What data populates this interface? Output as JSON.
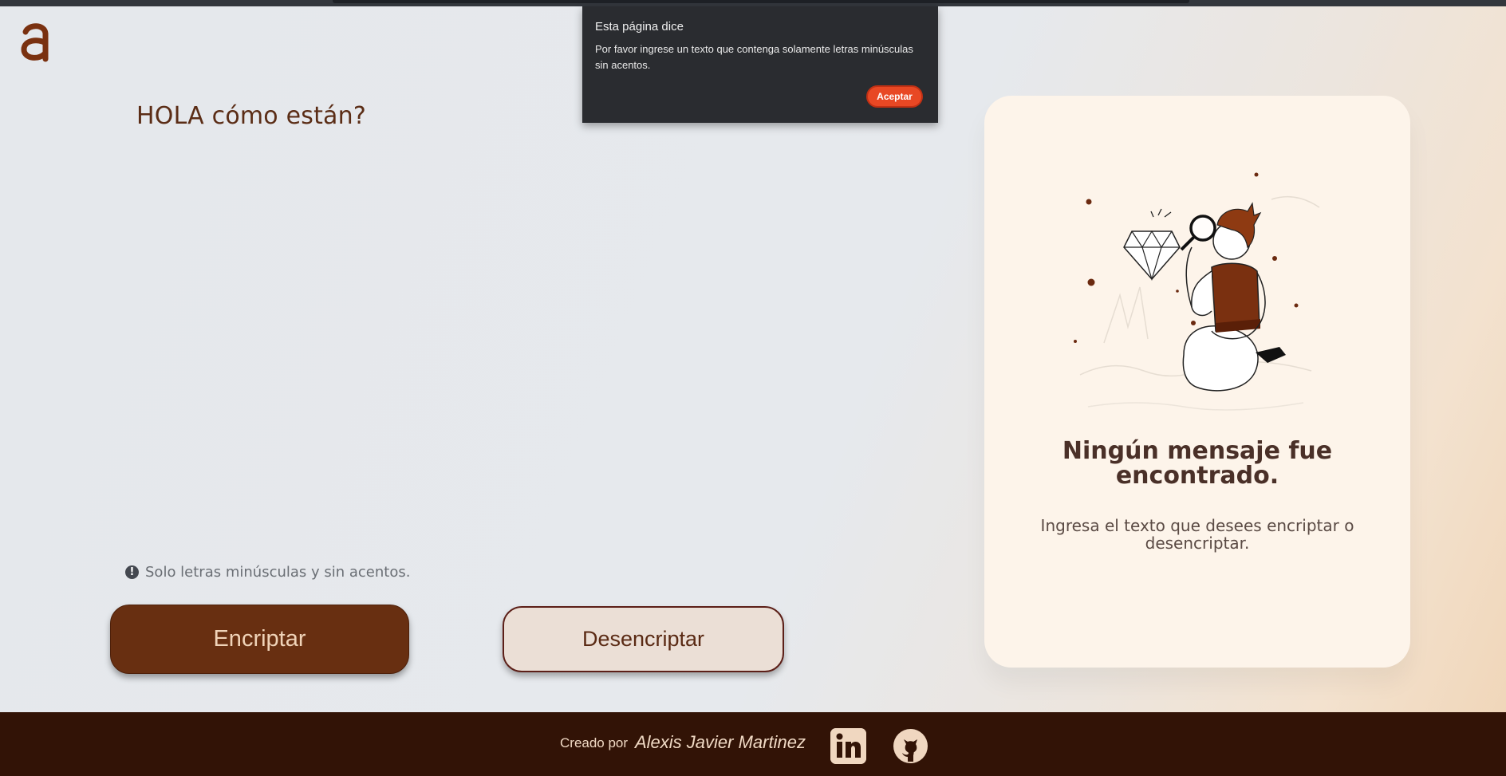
{
  "logo": {
    "icon": "letter-a-logo-icon",
    "color": "#7a3110"
  },
  "editor": {
    "text": "HOLA cómo están?"
  },
  "hint": {
    "icon": "exclamation-circle-icon",
    "text": "Solo letras minúsculas y sin acentos."
  },
  "buttons": {
    "encrypt": "Encriptar",
    "decrypt": "Desencriptar"
  },
  "output_card": {
    "illustration": "person-examining-diamond-with-magnifier-illustration",
    "title": "Ningún mensaje fue encontrado.",
    "subtitle": "Ingresa el texto que desees encriptar o desencriptar."
  },
  "dialog": {
    "title": "Esta página dice",
    "message": "Por favor ingrese un texto que contenga solamente letras minúsculas sin acentos.",
    "ok_label": "Aceptar"
  },
  "footer": {
    "created_by_label": "Creado por",
    "author": "Alexis Javier Martinez",
    "linkedin_icon": "linkedin-icon",
    "github_icon": "github-icon"
  },
  "colors": {
    "primary_brown": "#682f11",
    "footer_bg": "#321306",
    "card_bg": "#fdf4ea",
    "dialog_accent": "#e84824"
  }
}
